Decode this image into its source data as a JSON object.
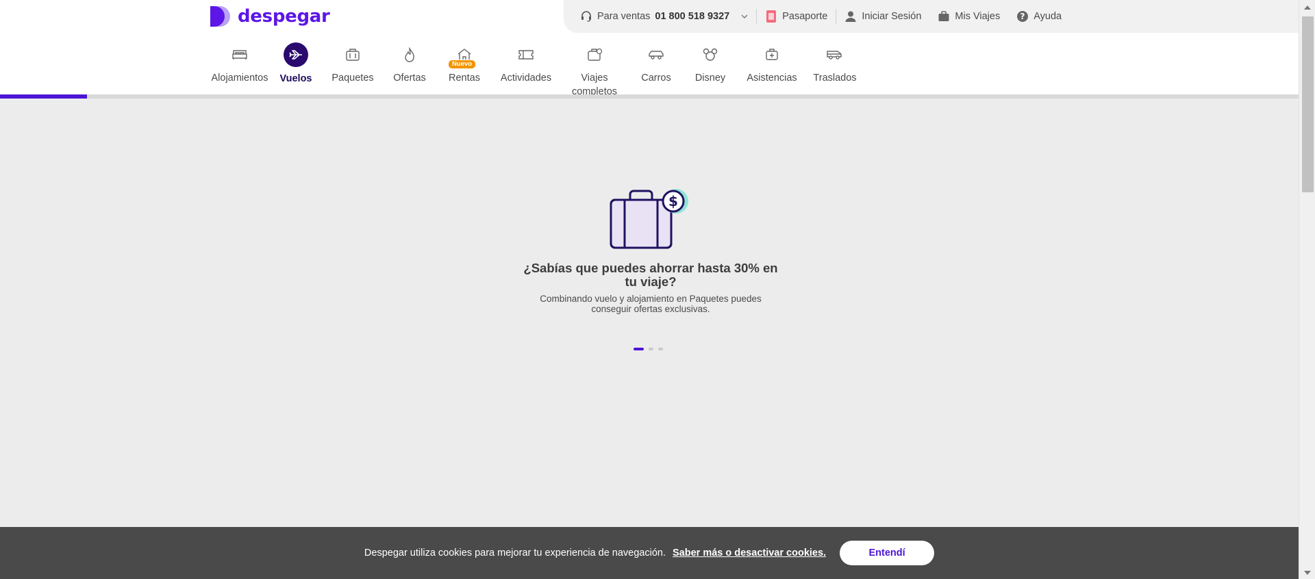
{
  "brand": {
    "name": "despegar",
    "accent": "#5c16e8",
    "dark_accent": "#2a0a6e"
  },
  "topbar": {
    "sales_label": "Para ventas",
    "sales_phone": "01 800 518 9327",
    "passport": "Pasaporte",
    "login": "Iniciar Sesión",
    "my_trips": "Mis Viajes",
    "help": "Ayuda"
  },
  "nav": {
    "items": [
      {
        "label": "Alojamientos",
        "icon": "bed-icon"
      },
      {
        "label": "Vuelos",
        "icon": "airplane-icon",
        "active": true
      },
      {
        "label": "Paquetes",
        "icon": "suitcase-icon"
      },
      {
        "label": "Ofertas",
        "icon": "flame-icon"
      },
      {
        "label": "Rentas",
        "icon": "house-icon",
        "badge": "Nuevo"
      },
      {
        "label": "Actividades",
        "icon": "ticket-icon"
      },
      {
        "label": "Viajes completos",
        "icon": "luggage-icon"
      },
      {
        "label": "Carros",
        "icon": "car-icon"
      },
      {
        "label": "Disney",
        "icon": "mickey-icon"
      },
      {
        "label": "Asistencias",
        "icon": "medical-kit-icon"
      },
      {
        "label": "Traslados",
        "icon": "van-icon"
      }
    ]
  },
  "main": {
    "headline": "¿Sabías que puedes ahorrar hasta 30% en tu viaje?",
    "subtext": "Combinando vuelo y alojamiento en Paquetes puedes conseguir ofertas exclusivas.",
    "carousel_slides": 3,
    "carousel_active": 1
  },
  "cookie": {
    "text": "Despegar utiliza cookies para mejorar tu experiencia de navegación.",
    "link": "Saber más o desactivar cookies.",
    "button": "Entendí"
  }
}
